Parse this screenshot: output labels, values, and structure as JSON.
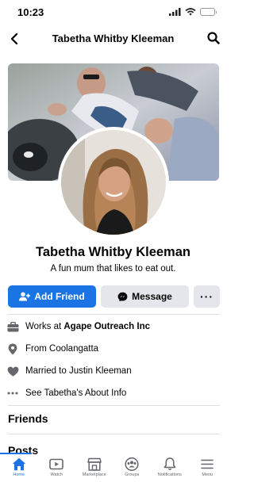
{
  "status_bar": {
    "time": "10:23"
  },
  "nav": {
    "title": "Tabetha Whitby Kleeman"
  },
  "profile": {
    "name": "Tabetha Whitby Kleeman",
    "bio": "A fun mum that likes to eat out."
  },
  "actions": {
    "add_friend": "Add Friend",
    "message": "Message",
    "more": "···"
  },
  "details": [
    {
      "icon": "briefcase-icon",
      "prefix": "Works at ",
      "bold": "Agape Outreach Inc"
    },
    {
      "icon": "location-pin-icon",
      "prefix": "From Coolangatta",
      "bold": ""
    },
    {
      "icon": "heart-icon",
      "prefix": "Married to Justin Kleeman",
      "bold": ""
    },
    {
      "icon": "more-dots-icon",
      "prefix": "See Tabetha's About Info",
      "bold": ""
    }
  ],
  "sections": {
    "friends": "Friends",
    "posts": "Posts"
  },
  "tabbar": [
    {
      "label": "Home",
      "icon": "home-icon",
      "active": true
    },
    {
      "label": "Watch",
      "icon": "video-icon",
      "active": false
    },
    {
      "label": "Marketplace",
      "icon": "marketplace-icon",
      "active": false
    },
    {
      "label": "Groups",
      "icon": "groups-icon",
      "active": false
    },
    {
      "label": "Notifications",
      "icon": "bell-icon",
      "active": false
    },
    {
      "label": "Menu",
      "icon": "menu-icon",
      "active": false
    }
  ],
  "colors": {
    "accent": "#1b74e4",
    "secondary_button": "#e4e6eb",
    "divider": "#dddfe2",
    "icon_gray": "#65676b"
  }
}
